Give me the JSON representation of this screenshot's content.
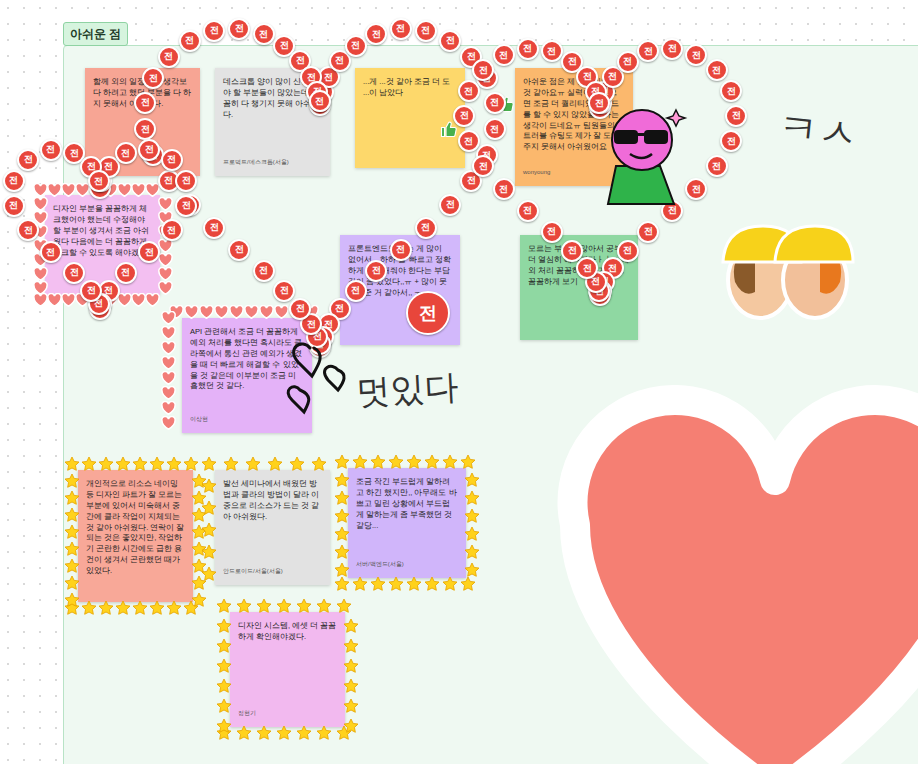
{
  "section": {
    "title": "아쉬운 점"
  },
  "notes": [
    {
      "text": "함께 외의 일정으로 생각보다 하려고 했던 부분을 다 하지 못해서 아쉬웠다.",
      "author": "",
      "color": "#f7a594"
    },
    {
      "text": "데스크톱 양이 많이 신경써야 할 부분들이 많았는데, 꼼꼼히 다 챙기지 못해 아쉬웠다.",
      "author": "프로덕트/데스크톱(서울)",
      "color": "#e3e3e3"
    },
    {
      "text": "...게 ...것 같아 조금 더 도 ...이 남았다",
      "author": "",
      "color": "#fdd86b"
    },
    {
      "text": "아쉬운 점은 제 실력이었던 것 같아요ㅠ 실력이 있었으면 조금 더 퀄리티있는 코드를 할 수 있지 않았을까하는 생각이 드네요ㅠ 팀원들의 트러블 슈팅도 제가 잘 도와주지 못해서 아쉬웠어요",
      "author": "wonyoung",
      "color": "#fbb86d"
    },
    {
      "text": "디자인 부분을 꼼꼼하게 체크했어야 했는데 수정해야 할 부분이 생겨서 조금 아쉬웠다 다음에는 더 꼼꼼하게 체크할 수 있도록 해야겠다.",
      "author": "",
      "color": "#f3bff1"
    },
    {
      "text": "프론트엔드도 아는 게 많이 없어서,,, 하하 늘 빠르고 정확하게 대답해줘야 한다는 부담감이 좀 있었다,,ㅠ + 많이 못 도와준 거 같아서,, ㅜ~",
      "author": "",
      "color": "#d2b8fb"
    },
    {
      "text": "모르는 부분이 많아서 공부 더 열심히 해야겠다ㅏㅏ + 예외 처리 꼼꼼하게 하기 코드 꼼꼼하게 보기",
      "author": "",
      "color": "#8fd8a2"
    },
    {
      "text": "API 관련해서 조금 더 꼼꼼하게 예외 처리를 했다면 혹시라도 클라쪽에서 통신 관련 예외가 생겼을 때 더 빠르게 해결할 수 있었을 것 같은데 이부분이 조금 미흡했던 것 같다.",
      "author": "이상현",
      "color": "#e4b2f8"
    },
    {
      "text": "개인적으로 리소스 네이밍 등 디자인 파트가 잘 모르는 부분에 있어서 미숙해서 중간에 클라 작업이 지체되는 것 같아 아쉬웠다. 연락이 잘 되는 것은 좋았지만, 작업하기 곤란한 시간에도 급한 용건이 생겨서 곤란했던 때가 있었다.",
      "author": "",
      "color": "#f8a898"
    },
    {
      "text": "발선 세미나에서 배웠던 방법과 클라의 방법이 달라 이중으로 리소스가 드는 것 같아 아쉬웠다.",
      "author": "안드로이드/서울(서울)",
      "color": "#e2e2e2"
    },
    {
      "text": "조금 작긴 부드럽게 말하려고 하긴 했지만,, 아무래도 바쁘고 밀린 상황에서 부드럽게 말하는게 좀 부족했던 것 같당...",
      "author": "서버/백엔드(서울)",
      "color": "#d0b5fa"
    },
    {
      "text": "디자인 시스템, 에셋 더 꼼꼼하게 확인해야겠다.",
      "author": "정현기",
      "color": "#f2b9ef"
    }
  ],
  "stamp": {
    "label": "전"
  },
  "handwriting": [
    "ㅋㅅ",
    "멋있다"
  ]
}
